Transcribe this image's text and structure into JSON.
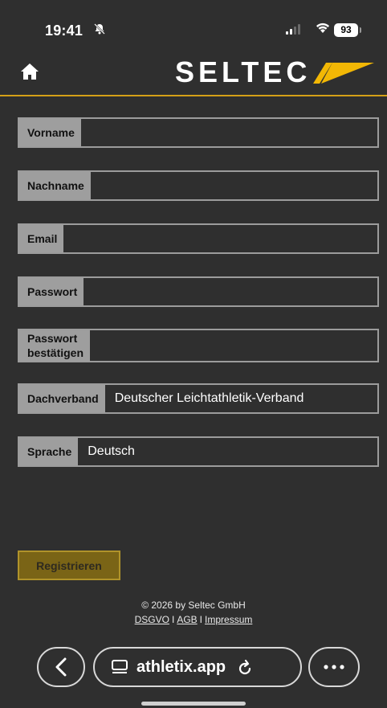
{
  "status_bar": {
    "time": "19:41",
    "battery": "93"
  },
  "header": {
    "logo_text": "SELTEC"
  },
  "form": {
    "fields": [
      {
        "label": "Vorname",
        "value": ""
      },
      {
        "label": "Nachname",
        "value": ""
      },
      {
        "label": "Email",
        "value": ""
      },
      {
        "label": "Passwort",
        "value": ""
      },
      {
        "label_line1": "Passwort",
        "label_line2": "bestätigen",
        "value": ""
      },
      {
        "label": "Dachverband",
        "value": "Deutscher Leichtathletik-Verband"
      },
      {
        "label": "Sprache",
        "value": "Deutsch"
      }
    ],
    "submit_label": "Registrieren"
  },
  "footer": {
    "copyright": "© 2026 by Seltec GmbH",
    "links": [
      "DSGVO",
      "AGB",
      "Impressum"
    ],
    "separator": "I"
  },
  "browser": {
    "url": "athletix.app"
  },
  "colors": {
    "background": "#2f2f2f",
    "accent": "#d4a017",
    "label_bg": "#9e9e9e",
    "button_bg": "#7a6416"
  }
}
